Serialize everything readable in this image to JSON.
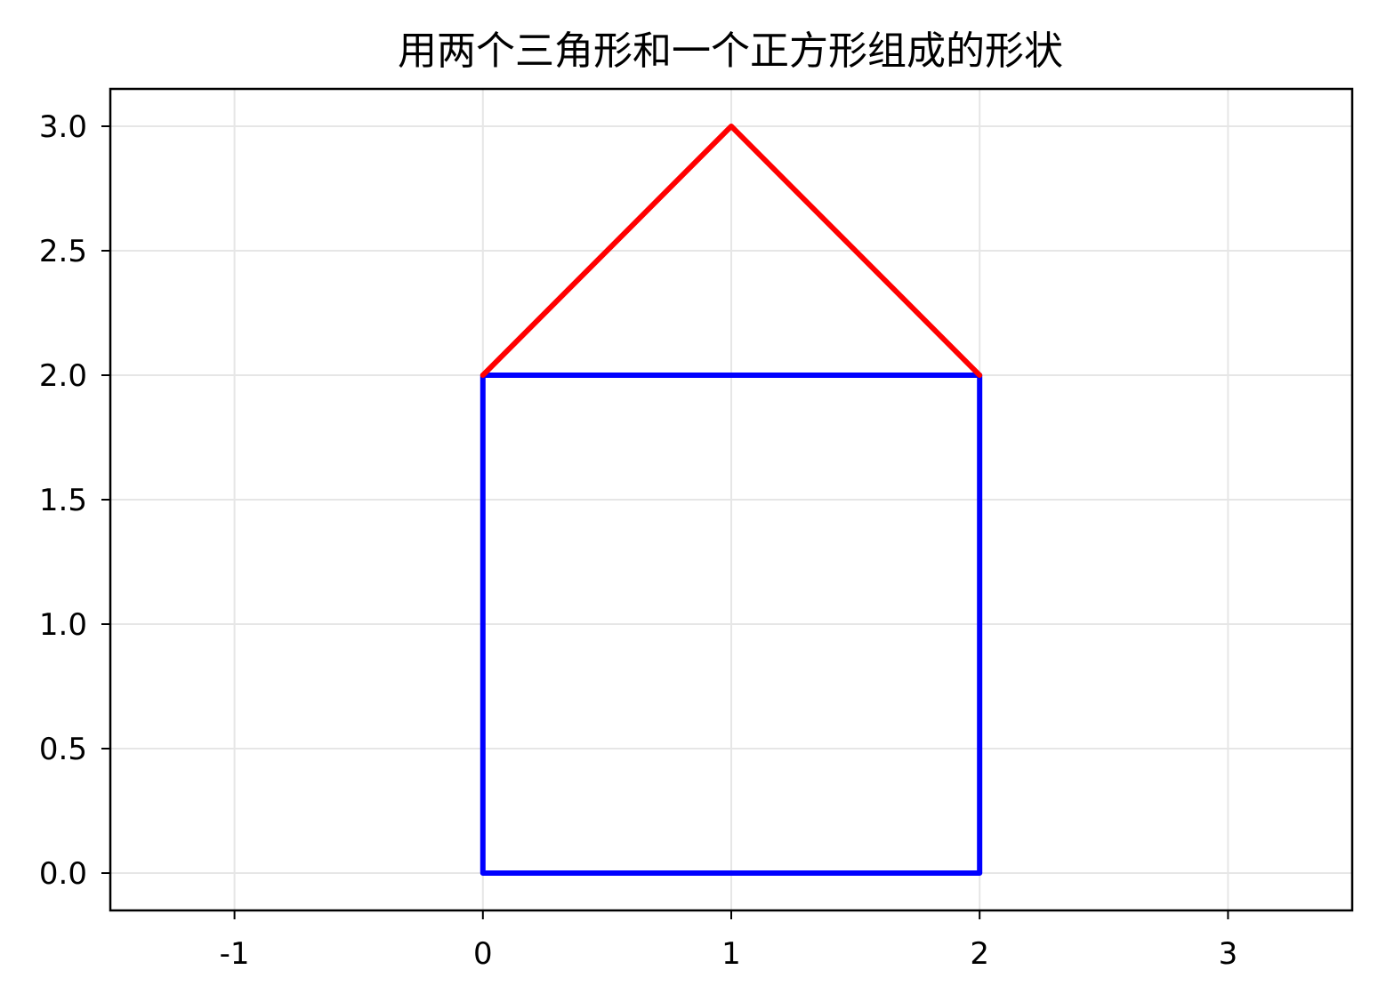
{
  "chart_data": {
    "type": "line",
    "title": "用两个三角形和一个正方形组成的形状",
    "xlabel": "",
    "ylabel": "",
    "xlim": [
      -1.5,
      3.5
    ],
    "ylim": [
      -0.15,
      3.15
    ],
    "xticks": [
      -1,
      0,
      1,
      2,
      3
    ],
    "xtick_labels": [
      "-1",
      "0",
      "1",
      "2",
      "3"
    ],
    "yticks": [
      0.0,
      0.5,
      1.0,
      1.5,
      2.0,
      2.5,
      3.0
    ],
    "ytick_labels": [
      "0.0",
      "0.5",
      "1.0",
      "1.5",
      "2.0",
      "2.5",
      "3.0"
    ],
    "grid": true,
    "legend": "none",
    "series": [
      {
        "color": "#0000ff",
        "x": [
          0,
          2,
          2,
          0,
          0
        ],
        "y": [
          0,
          0,
          2,
          2,
          0
        ]
      },
      {
        "color": "#ff0000",
        "x": [
          0,
          1,
          2
        ],
        "y": [
          2,
          3,
          2
        ]
      }
    ]
  }
}
